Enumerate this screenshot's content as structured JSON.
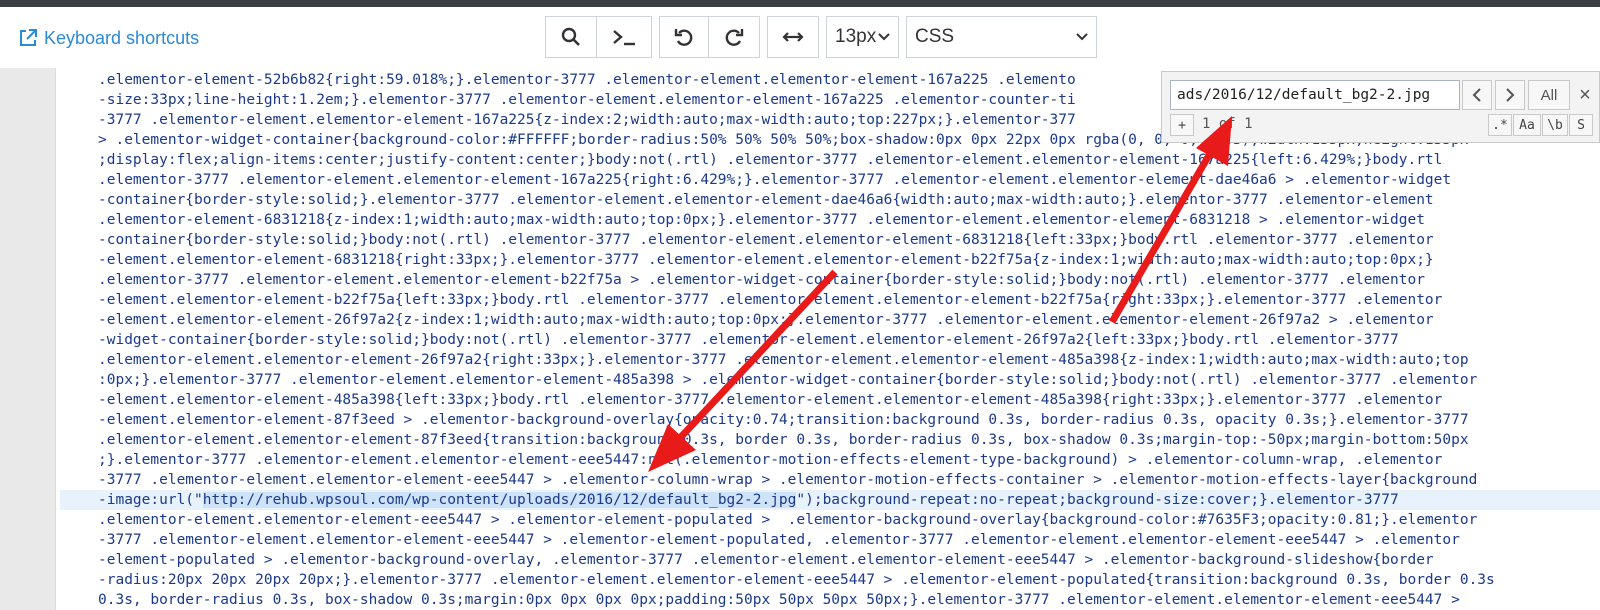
{
  "toolbar": {
    "shortcuts_label": "Keyboard shortcuts",
    "font_size": "13px",
    "mode": "CSS"
  },
  "find": {
    "query": "ads/2016/12/default_bg2-2.jpg",
    "count": "1 of 1",
    "all_label": "All",
    "plus_label": "+",
    "regex_label": ".*",
    "case_label": "Aa",
    "word_label": "\\b",
    "sel_label": "S",
    "close_label": "×"
  },
  "code_lines": [
    ".elementor-element-52b6b82{right:59.018%;}.elementor-3777 .elementor-element.elementor-element-167a225 .elemento",
    "-size:33px;line-height:1.2em;}.elementor-3777 .elementor-element.elementor-element-167a225 .elementor-counter-ti",
    "-3777 .elementor-element.elementor-element-167a225{z-index:2;width:auto;max-width:auto;top:227px;}.elementor-377",
    "> .elementor-widget-container{background-color:#FFFFFF;border-radius:50% 50% 50% 50%;box-shadow:0px 0px 22px 0px rgba(0, 0, 0, 0.03);width:135px;height:135px",
    ";display:flex;align-items:center;justify-content:center;}body:not(.rtl) .elementor-3777 .elementor-element.elementor-element-167a225{left:6.429%;}body.rtl",
    ".elementor-3777 .elementor-element.elementor-element-167a225{right:6.429%;}.elementor-3777 .elementor-element.elementor-element-dae46a6 > .elementor-widget",
    "-container{border-style:solid;}.elementor-3777 .elementor-element.elementor-element-dae46a6{width:auto;max-width:auto;}.elementor-3777 .elementor-element",
    ".elementor-element-6831218{z-index:1;width:auto;max-width:auto;top:0px;}.elementor-3777 .elementor-element.elementor-element-6831218 > .elementor-widget",
    "-container{border-style:solid;}body:not(.rtl) .elementor-3777 .elementor-element.elementor-element-6831218{left:33px;}body.rtl .elementor-3777 .elementor",
    "-element.elementor-element-6831218{right:33px;}.elementor-3777 .elementor-element.elementor-element-b22f75a{z-index:1;width:auto;max-width:auto;top:0px;}",
    ".elementor-3777 .elementor-element.elementor-element-b22f75a > .elementor-widget-container{border-style:solid;}body:not(.rtl) .elementor-3777 .elementor",
    "-element.elementor-element-b22f75a{left:33px;}body.rtl .elementor-3777 .elementor-element.elementor-element-b22f75a{right:33px;}.elementor-3777 .elementor",
    "-element.elementor-element-26f97a2{z-index:1;width:auto;max-width:auto;top:0px;}.elementor-3777 .elementor-element.elementor-element-26f97a2 > .elementor",
    "-widget-container{border-style:solid;}body:not(.rtl) .elementor-3777 .elementor-element.elementor-element-26f97a2{left:33px;}body.rtl .elementor-3777",
    ".elementor-element.elementor-element-26f97a2{right:33px;}.elementor-3777 .elementor-element.elementor-element-485a398{z-index:1;width:auto;max-width:auto;top",
    ":0px;}.elementor-3777 .elementor-element.elementor-element-485a398 > .elementor-widget-container{border-style:solid;}body:not(.rtl) .elementor-3777 .elementor",
    "-element.elementor-element-485a398{left:33px;}body.rtl .elementor-3777 .elementor-element.elementor-element-485a398{right:33px;}.elementor-3777 .elementor",
    "-element.elementor-element-87f3eed > .elementor-background-overlay{opacity:0.74;transition:background 0.3s, border-radius 0.3s, opacity 0.3s;}.elementor-3777",
    ".elementor-element.elementor-element-87f3eed{transition:background 0.3s, border 0.3s, border-radius 0.3s, box-shadow 0.3s;margin-top:-50px;margin-bottom:50px",
    ";}.elementor-3777 .elementor-element.elementor-element-eee5447:not(.elementor-motion-effects-element-type-background) > .elementor-column-wrap, .elementor",
    "-3777 .elementor-element.elementor-element-eee5447 > .elementor-column-wrap > .elementor-motion-effects-container > .elementor-motion-effects-layer{background",
    "-image:url(\"http://rehub.wpsoul.com/wp-content/uploads/2016/12/default_bg2-2.jpg\");background-repeat:no-repeat;background-size:cover;}.elementor-3777",
    ".elementor-element.elementor-element-eee5447 > .elementor-element-populated >  .elementor-background-overlay{background-color:#7635F3;opacity:0.81;}.elementor",
    "-3777 .elementor-element.elementor-element-eee5447 > .elementor-element-populated, .elementor-3777 .elementor-element.elementor-element-eee5447 > .elementor",
    "-element-populated > .elementor-background-overlay, .elementor-3777 .elementor-element.elementor-element-eee5447 > .elementor-background-slideshow{border",
    "-radius:20px 20px 20px 20px;}.elementor-3777 .elementor-element.elementor-element-eee5447 > .elementor-element-populated{transition:background 0.3s, border 0.3s",
    "0.3s, border-radius 0.3s, box-shadow 0.3s;margin:0px 0px 0px 0px;padding:50px 50px 50px 50px;}.elementor-3777 .elementor-element.elementor-element-eee5447 >"
  ],
  "highlight": "http://rehub.wpsoul.com/wp-content/uploads/2016/12/default_bg2-2.jpg",
  "active_line": 21
}
